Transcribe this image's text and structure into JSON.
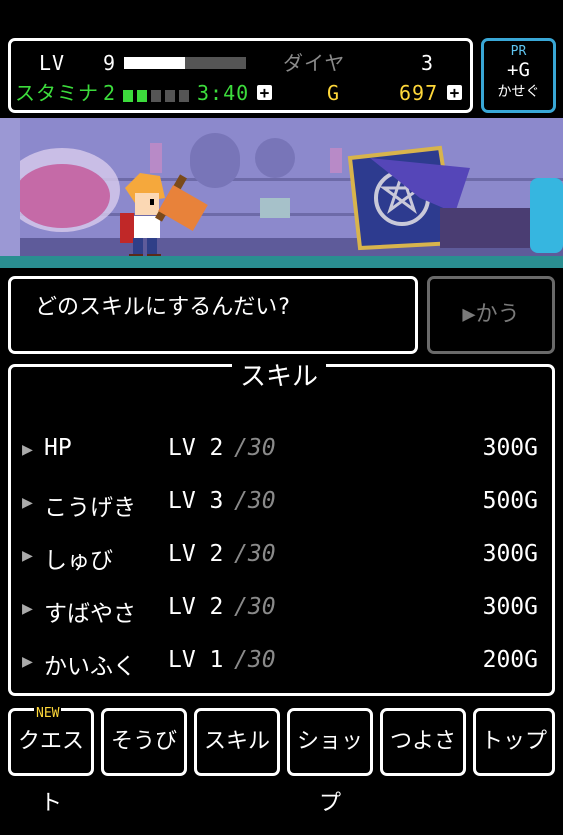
{
  "status": {
    "lv_label": "LV",
    "lv_value": "9",
    "lv_progress": 0.5,
    "diamond_label": "ダイヤ",
    "diamond_value": "3",
    "stamina_label": "スタミナ",
    "stamina_value": "2",
    "stamina_filled": 2,
    "stamina_total": 5,
    "stamina_timer": "3:40",
    "gold_label": "G",
    "gold_value": "697"
  },
  "pr_button": {
    "top": "PR",
    "middle": "+G",
    "bottom": "かせぐ"
  },
  "dialog": {
    "message": "どのスキルにするんだい?"
  },
  "buy_button": {
    "label": "▶かう"
  },
  "skills": {
    "title": "スキル",
    "items": [
      {
        "name": "HP",
        "lv": "LV 2",
        "max": "/30",
        "cost": "300G"
      },
      {
        "name": "こうげき",
        "lv": "LV 3",
        "max": "/30",
        "cost": "500G"
      },
      {
        "name": "しゅび",
        "lv": "LV 2",
        "max": "/30",
        "cost": "300G"
      },
      {
        "name": "すばやさ",
        "lv": "LV 2",
        "max": "/30",
        "cost": "300G"
      },
      {
        "name": "かいふく",
        "lv": "LV 1",
        "max": "/30",
        "cost": "200G"
      }
    ]
  },
  "tabs": {
    "new_badge": "NEW",
    "quest": "クエスト",
    "equip": "そうび",
    "skill": "スキル",
    "shop": "ショップ",
    "stats": "つよさ",
    "top": "トップ"
  },
  "colors": {
    "stamina": "#3cdc3c",
    "gold": "#ffd83a",
    "pr": "#5fc4ef"
  }
}
